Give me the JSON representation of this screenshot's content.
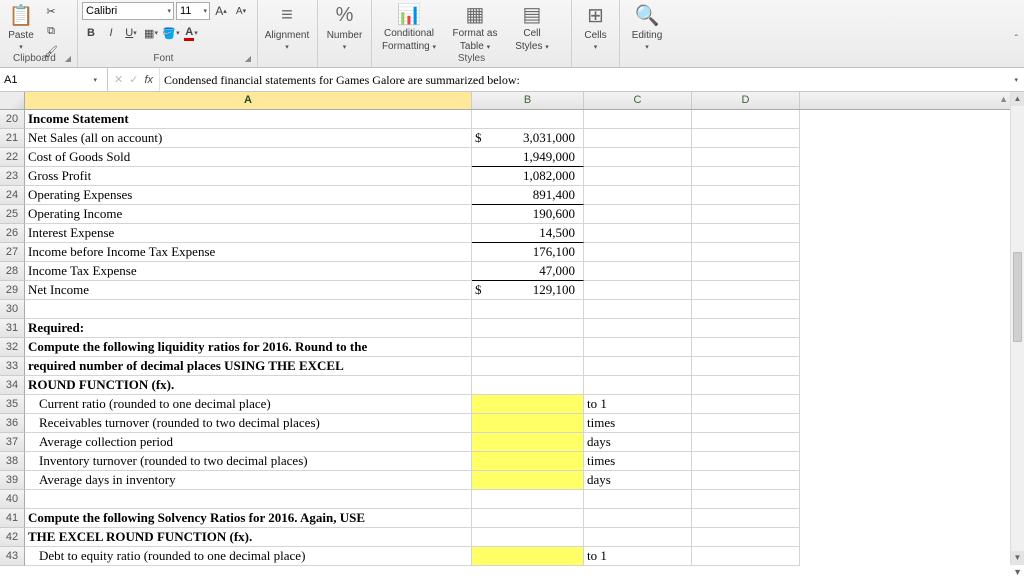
{
  "ribbon": {
    "paste": "Paste",
    "font_name": "Calibri",
    "font_size": "11",
    "alignment": "Alignment",
    "number": "Number",
    "cond_fmt_l1": "Conditional",
    "cond_fmt_l2": "Formatting",
    "fmt_table_l1": "Format as",
    "fmt_table_l2": "Table",
    "cell_styles_l1": "Cell",
    "cell_styles_l2": "Styles",
    "cells": "Cells",
    "editing": "Editing",
    "grp_clipboard": "Clipboard",
    "grp_font": "Font",
    "grp_styles": "Styles"
  },
  "namebox": "A1",
  "formula": "Condensed financial statements for Games Galore are summarized below:",
  "cols": [
    "A",
    "B",
    "C",
    "D"
  ],
  "rows": [
    {
      "n": 20,
      "a": "Income Statement",
      "bold": true
    },
    {
      "n": 21,
      "a": "Net Sales (all on account)",
      "b_dollar": "3,031,000"
    },
    {
      "n": 22,
      "a": "Cost of Goods Sold",
      "b": "1,949,000",
      "bthick": true
    },
    {
      "n": 23,
      "a": "Gross Profit",
      "b": "1,082,000"
    },
    {
      "n": 24,
      "a": "Operating Expenses",
      "b": "891,400",
      "bthick": true
    },
    {
      "n": 25,
      "a": "Operating Income",
      "b": "190,600"
    },
    {
      "n": 26,
      "a": "Interest Expense",
      "b": "14,500",
      "bthick": true
    },
    {
      "n": 27,
      "a": "Income before Income Tax Expense",
      "b": "176,100"
    },
    {
      "n": 28,
      "a": "Income Tax Expense",
      "b": "47,000",
      "bthick": true
    },
    {
      "n": 29,
      "a": "Net Income",
      "b_dollar": "129,100"
    },
    {
      "n": 30,
      "a": ""
    },
    {
      "n": 31,
      "a": "Required:",
      "bold": true
    },
    {
      "n": 32,
      "a": "Compute the following liquidity ratios for 2016. Round to the",
      "bold": true
    },
    {
      "n": 33,
      "a": "required number of decimal places USING THE EXCEL",
      "bold": true
    },
    {
      "n": 34,
      "a": "ROUND FUNCTION (fx).",
      "bold": true
    },
    {
      "n": 35,
      "a": "Current ratio (rounded to one decimal place)",
      "indent": true,
      "byellow": true,
      "c": "to 1"
    },
    {
      "n": 36,
      "a": "Receivables turnover (rounded to two decimal places)",
      "indent": true,
      "byellow": true,
      "c": "times"
    },
    {
      "n": 37,
      "a": "Average collection period",
      "indent": true,
      "byellow": true,
      "c": "days"
    },
    {
      "n": 38,
      "a": "Inventory turnover (rounded to two decimal places)",
      "indent": true,
      "byellow": true,
      "c": "times"
    },
    {
      "n": 39,
      "a": "Average days in inventory",
      "indent": true,
      "byellow": true,
      "c": "days"
    },
    {
      "n": 40,
      "a": ""
    },
    {
      "n": 41,
      "a": "Compute the following Solvency Ratios for 2016. Again, USE",
      "bold": true
    },
    {
      "n": 42,
      "a": "THE EXCEL ROUND FUNCTION (fx).",
      "bold": true
    },
    {
      "n": 43,
      "a": "Debt to equity ratio (rounded to one decimal place)",
      "indent": true,
      "byellow": true,
      "c": "to 1"
    }
  ]
}
